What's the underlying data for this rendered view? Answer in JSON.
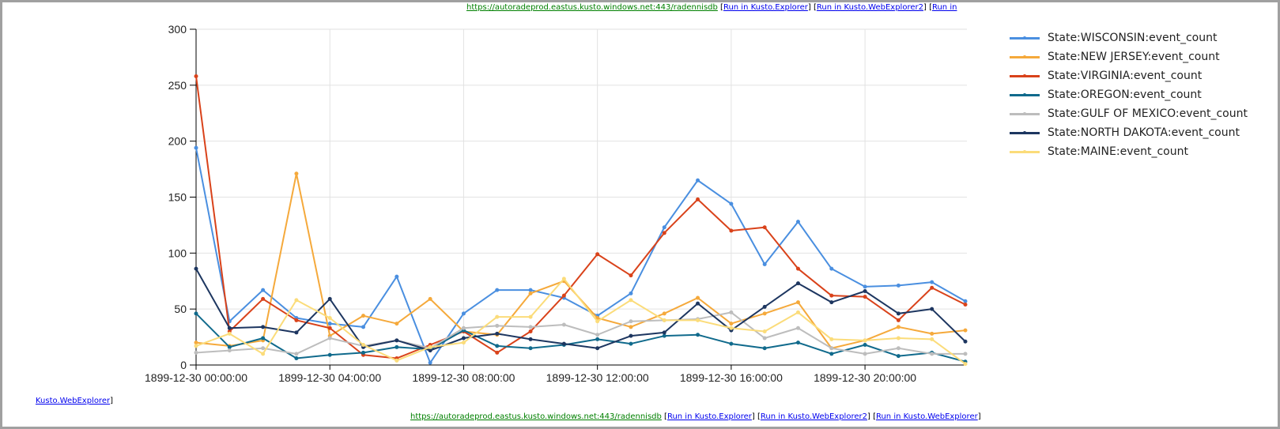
{
  "top_links": {
    "connection": "https://autoradeprod.eastus.kusto.windows.net:443/radennisdb",
    "run_explorer": "Run in Kusto.Explorer",
    "run_webexplorer2": "Run in Kusto.WebExplorer2",
    "run_partial": "Run in"
  },
  "wrap_link": {
    "text": "Kusto.WebExplorer",
    "bracket": "]"
  },
  "bottom_links": {
    "connection": "https://autoradeprod.eastus.kusto.windows.net:443/radennisdb",
    "run_explorer": "Run in Kusto.Explorer",
    "run_webexplorer2": "Run in Kusto.WebExplorer2",
    "run_webexplorer": "Run in Kusto.WebExplorer"
  },
  "chart_data": {
    "type": "line",
    "title": "",
    "xlabel": "",
    "ylabel": "",
    "ylim": [
      0,
      300
    ],
    "yticks": [
      0,
      50,
      100,
      150,
      200,
      250,
      300
    ],
    "xticks": [
      "1899-12-30 00:00:00",
      "1899-12-30 04:00:00",
      "1899-12-30 08:00:00",
      "1899-12-30 12:00:00",
      "1899-12-30 16:00:00",
      "1899-12-30 20:00:00"
    ],
    "x": [
      "00:00",
      "01:00",
      "02:00",
      "03:00",
      "04:00",
      "05:00",
      "06:00",
      "07:00",
      "08:00",
      "09:00",
      "10:00",
      "11:00",
      "12:00",
      "13:00",
      "14:00",
      "15:00",
      "16:00",
      "17:00",
      "18:00",
      "19:00",
      "20:00",
      "21:00",
      "22:00",
      "23:00"
    ],
    "x_date": "1899-12-30",
    "grid": true,
    "legend_position": "right",
    "series": [
      {
        "name": "State:WISCONSIN:event_count",
        "color": "#4a8fe0",
        "values": [
          194,
          39,
          67,
          42,
          37,
          34,
          79,
          2,
          46,
          67,
          67,
          60,
          44,
          64,
          123,
          165,
          144,
          90,
          128,
          86,
          70,
          71,
          74,
          57
        ]
      },
      {
        "name": "State:NEW JERSEY:event_count",
        "color": "#f5a93b",
        "values": [
          20,
          17,
          22,
          171,
          26,
          44,
          37,
          59,
          30,
          27,
          64,
          75,
          42,
          34,
          46,
          60,
          37,
          46,
          56,
          15,
          22,
          34,
          28,
          31
        ]
      },
      {
        "name": "State:VIRGINIA:event_count",
        "color": "#d9421a",
        "values": [
          258,
          30,
          59,
          40,
          33,
          9,
          6,
          18,
          30,
          11,
          30,
          62,
          99,
          80,
          118,
          148,
          120,
          123,
          86,
          62,
          61,
          40,
          69,
          54
        ]
      },
      {
        "name": "State:OREGON:event_count",
        "color": "#106a8c",
        "values": [
          46,
          16,
          24,
          6,
          9,
          11,
          16,
          14,
          31,
          17,
          15,
          18,
          23,
          19,
          26,
          27,
          19,
          15,
          20,
          10,
          18,
          8,
          11,
          3
        ]
      },
      {
        "name": "State:GULF OF MEXICO:event_count",
        "color": "#bdbdbd",
        "values": [
          11,
          13,
          15,
          10,
          24,
          17,
          22,
          15,
          33,
          35,
          34,
          36,
          27,
          39,
          40,
          41,
          47,
          24,
          33,
          15,
          10,
          15,
          10,
          10
        ]
      },
      {
        "name": "State:NORTH DAKOTA:event_count",
        "color": "#1d3660",
        "values": [
          86,
          33,
          34,
          29,
          59,
          16,
          22,
          13,
          24,
          28,
          23,
          19,
          15,
          26,
          29,
          55,
          31,
          52,
          73,
          56,
          66,
          46,
          50,
          21
        ]
      },
      {
        "name": "State:MAINE:event_count",
        "color": "#fbdc7a",
        "values": [
          17,
          28,
          10,
          58,
          42,
          18,
          4,
          16,
          20,
          43,
          43,
          77,
          39,
          58,
          40,
          40,
          33,
          30,
          47,
          23,
          22,
          24,
          23,
          1
        ]
      }
    ]
  }
}
